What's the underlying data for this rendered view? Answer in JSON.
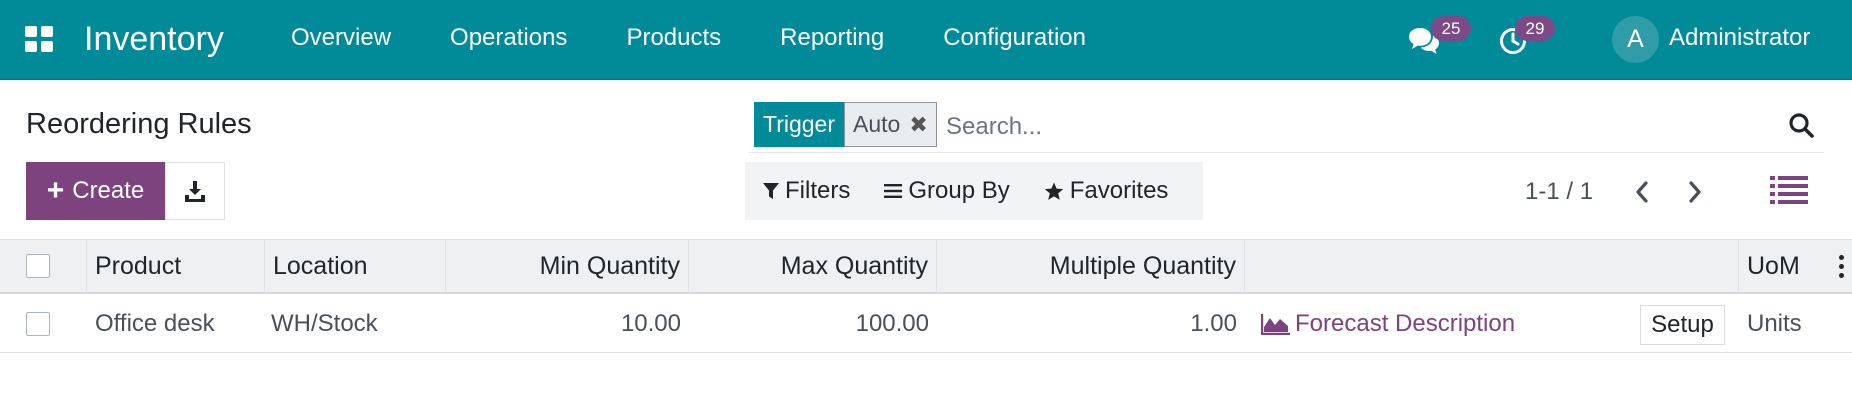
{
  "navbar": {
    "app_name": "Inventory",
    "menu": [
      "Overview",
      "Operations",
      "Products",
      "Reporting",
      "Configuration"
    ],
    "chat_count": "25",
    "activity_count": "29",
    "user_initial": "A",
    "user_name": "Administrator",
    "icons": {
      "apps": "apps-grid-icon",
      "chat": "chat-bubbles-icon",
      "activity": "clock-icon"
    },
    "color": "#018a98"
  },
  "control_panel": {
    "title": "Reordering Rules",
    "create_label": "Create",
    "search": {
      "facet_label": "Trigger",
      "facet_value": "Auto",
      "placeholder": "Search..."
    },
    "filters": {
      "filters_label": "Filters",
      "group_by_label": "Group By",
      "favorites_label": "Favorites"
    },
    "pager": "1-1 / 1",
    "accent": "#7c437f"
  },
  "table": {
    "columns": [
      "Product",
      "Location",
      "Min Quantity",
      "Max Quantity",
      "Multiple Quantity",
      "",
      "UoM"
    ],
    "rows": [
      {
        "product": "Office desk",
        "location": "WH/Stock",
        "min_qty": "10.00",
        "max_qty": "100.00",
        "multiple_qty": "1.00",
        "forecast_label": "Forecast Description",
        "setup_label": "Setup",
        "uom": "Units"
      }
    ]
  }
}
